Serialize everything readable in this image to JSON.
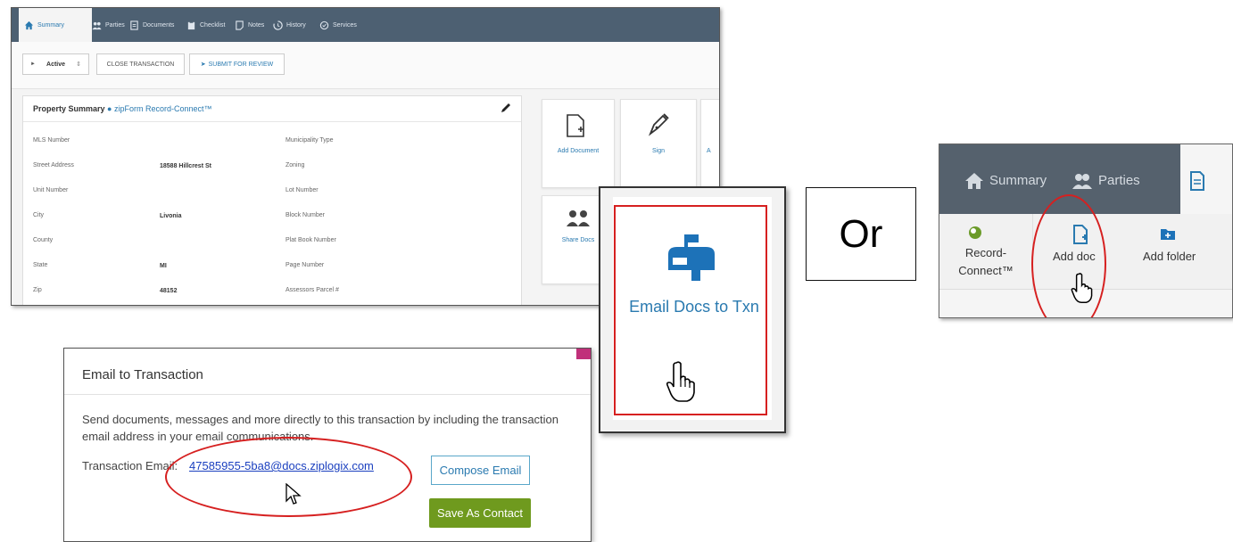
{
  "main_screenshot": {
    "nav_tabs": [
      {
        "label": "Summary",
        "icon": "home-icon",
        "active": true
      },
      {
        "label": "Parties",
        "icon": "people-icon"
      },
      {
        "label": "Documents",
        "icon": "document-icon"
      },
      {
        "label": "Checklist",
        "icon": "clipboard-icon"
      },
      {
        "label": "Notes",
        "icon": "note-icon"
      },
      {
        "label": "History",
        "icon": "history-icon"
      },
      {
        "label": "Services",
        "icon": "badge-icon"
      }
    ],
    "toolbar": {
      "status_select": "Active",
      "close_transaction": "CLOSE TRANSACTION",
      "submit_for_review": "SUBMIT FOR REVIEW"
    },
    "property_summary": {
      "title": "Property Summary",
      "brand": "zipForm Record-Connect™",
      "left_fields": [
        {
          "label": "MLS Number",
          "value": ""
        },
        {
          "label": "Street Address",
          "value": "18588 Hillcrest St"
        },
        {
          "label": "Unit Number",
          "value": ""
        },
        {
          "label": "City",
          "value": "Livonia"
        },
        {
          "label": "County",
          "value": ""
        },
        {
          "label": "State",
          "value": "MI"
        },
        {
          "label": "Zip",
          "value": "48152"
        }
      ],
      "right_fields": [
        {
          "label": "Municipality Type"
        },
        {
          "label": "Zoning"
        },
        {
          "label": "Lot Number"
        },
        {
          "label": "Block Number"
        },
        {
          "label": "Plat Book Number"
        },
        {
          "label": "Page Number"
        },
        {
          "label": "Assessors Parcel #"
        }
      ]
    },
    "tiles": {
      "add_document": "Add Document",
      "sign": "Sign",
      "cut_label": "A",
      "share_docs": "Share Docs"
    }
  },
  "email_docs_card": {
    "label": "Email Docs to Txn",
    "icon": "mailbox-icon"
  },
  "or_text": "Or",
  "adddoc_screenshot": {
    "nav": {
      "summary": "Summary",
      "parties": "Parties"
    },
    "buttons": {
      "record_connect": "Record-Connect™",
      "add_doc": "Add doc",
      "add_folder": "Add folder"
    }
  },
  "email_dialog": {
    "title": "Email to Transaction",
    "description": "Send documents, messages and more directly to this transaction by including the transaction email address in your email communications.",
    "email_label": "Transaction Email:",
    "email_address": "47585955-5ba8@docs.ziplogix.com",
    "compose_button": "Compose Email",
    "save_contact_button": "Save As Contact"
  },
  "colors": {
    "nav_bg": "#4d6072",
    "accent_blue": "#2a7ab0",
    "highlight_red": "#d62020",
    "save_green": "#6f9a1e"
  }
}
